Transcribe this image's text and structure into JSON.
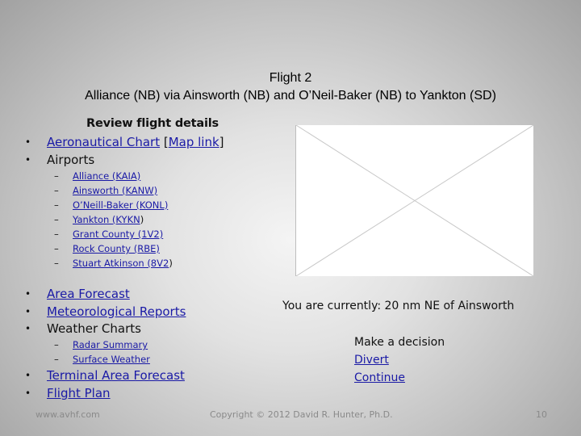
{
  "title": {
    "line1": "Flight 2",
    "line2": "Alliance (NB) via Ainsworth (NB) and O’Neil-Baker (NB) to Yankton (SD)"
  },
  "review": {
    "heading": "Review flight details",
    "chart_link": "Aeronautical Chart",
    "bracket_open": " [",
    "map_link": "Map link",
    "bracket_close": "]",
    "airports_label": "Airports",
    "airports": [
      {
        "name": "Alliance (KAIA)",
        "suffix": ""
      },
      {
        "name": "Ainsworth (KANW)",
        "suffix": ""
      },
      {
        "name": "O’Neill-Baker (KONL)",
        "suffix": ""
      },
      {
        "name": "Yankton (KYKN",
        "suffix": ")"
      },
      {
        "name": "Grant County (1V2)",
        "suffix": ""
      },
      {
        "name": "Rock County (RBE)",
        "suffix": ""
      },
      {
        "name": "Stuart Atkinson (8V2",
        "suffix": ")"
      }
    ],
    "area_forecast": "Area Forecast",
    "met_reports": "Meteorological Reports",
    "weather_charts_label": "Weather Charts",
    "weather_charts": [
      "Radar Summary",
      "Surface Weather"
    ],
    "terminal_forecast": "Terminal Area Forecast",
    "flight_plan": "Flight Plan",
    "bullet": "•",
    "dash": "–"
  },
  "status": {
    "position": "You are currently: 20 nm NE of Ainsworth"
  },
  "decision": {
    "heading": "Make a decision",
    "options": [
      "Divert",
      "Continue"
    ]
  },
  "footer": {
    "site": "www.avhf.com",
    "copyright": "Copyright © 2012 David R. Hunter, Ph.D.",
    "page_number": "10"
  },
  "colors": {
    "link": "#1a1aa6",
    "text": "#111111",
    "footer_text": "#8a8a8a"
  }
}
